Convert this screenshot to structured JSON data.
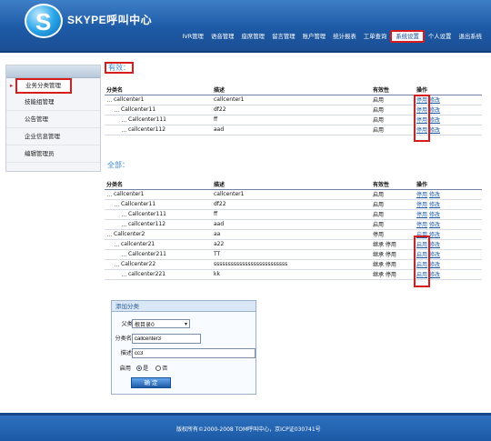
{
  "brand": "SKYPE呼叫中心",
  "nav": [
    "IVR管理",
    "语音管理",
    "座席管理",
    "留言管理",
    "账户管理",
    "统计报表",
    "工单查询",
    "系统设置",
    "个人设置",
    "退出系统"
  ],
  "sidebar": [
    "业务分类管理",
    "技能组管理",
    "公告管理",
    "企业信息管理",
    "编辑管理员"
  ],
  "valid": {
    "title": "有效：",
    "headers": [
      "分类名",
      "描述",
      "有效性",
      "操作"
    ],
    "rows": [
      [
        "callcenter1",
        "callcenter1",
        "启用",
        "停用",
        "修改"
      ],
      [
        "Callcenter11",
        "df22",
        "启用",
        "停用",
        "修改"
      ],
      [
        "Callcenter111",
        "ff",
        "启用",
        "停用",
        "修改"
      ],
      [
        "callcenter112",
        "aad",
        "启用",
        "停用",
        "修改"
      ]
    ]
  },
  "all": {
    "title": "全部：",
    "headers": [
      "分类名",
      "描述",
      "有效性",
      "操作"
    ],
    "rows": [
      [
        "callcenter1",
        "callcenter1",
        "启用",
        "停用",
        "修改"
      ],
      [
        "Callcenter11",
        "df22",
        "启用",
        "停用",
        "修改"
      ],
      [
        "Callcenter111",
        "ff",
        "启用",
        "停用",
        "修改"
      ],
      [
        "callcenter112",
        "aad",
        "启用",
        "停用",
        "修改"
      ],
      [
        "Callcenter2",
        "aa",
        "停用",
        "启用",
        "修改"
      ],
      [
        "callcenter21",
        "a22",
        "继承 停用",
        "启用",
        "修改"
      ],
      [
        "Callcenter211",
        "TT",
        "继承 停用",
        "启用",
        "修改"
      ],
      [
        "Callcenter22",
        "ssssssssssssssssssssssssss",
        "继承 停用",
        "启用",
        "修改"
      ],
      [
        "callcenter221",
        "kk",
        "继承 停用",
        "启用",
        "修改"
      ]
    ]
  },
  "add": {
    "title": "添加分类",
    "parent_label": "父类",
    "parent_value": "根目录0",
    "name_label": "分类名",
    "name_value": "callcenter3",
    "desc_label": "描述",
    "desc_value": "cc3",
    "enable_label": "启用",
    "yes": "是",
    "no": "否",
    "submit": "确 定"
  },
  "footer": "版权所有©2000-2008 TOM呼叫中心，京ICP证030741号"
}
